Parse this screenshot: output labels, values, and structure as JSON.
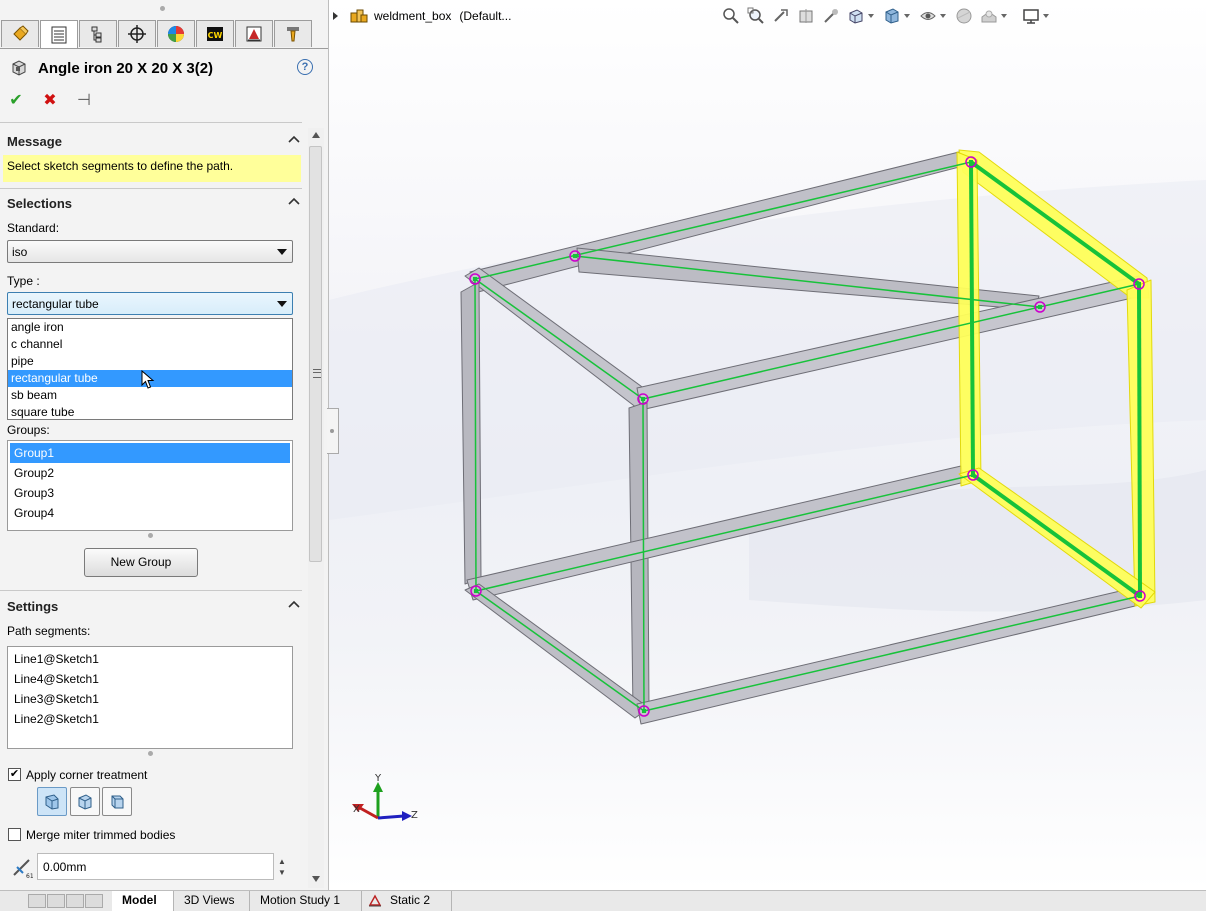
{
  "property_manager": {
    "title": "Angle iron 20 X 20 X 3(2)",
    "help": "?",
    "ok": "✔",
    "cancel": "✖",
    "pin": "⊣",
    "tabs": [
      "feature-manager",
      "property-manager",
      "configuration-manager",
      "dim-xpert-manager",
      "display-manager",
      "cam-manager",
      "simulation",
      "tool"
    ],
    "message": {
      "header": "Message",
      "text": "Select sketch segments to define the path."
    },
    "selections": {
      "header": "Selections",
      "standard_label": "Standard:",
      "standard_value": "iso",
      "type_label": "Type :",
      "type_value": "rectangular tube",
      "type_options": [
        "angle iron",
        "c channel",
        "pipe",
        "rectangular tube",
        "sb beam",
        "square tube"
      ],
      "type_selected_index": 3,
      "groups_label": "Groups:",
      "groups": [
        "Group1",
        "Group2",
        "Group3",
        "Group4"
      ],
      "groups_selected_index": 0,
      "new_group_label": "New Group"
    },
    "settings": {
      "header": "Settings",
      "path_label": "Path segments:",
      "path_segments": [
        "Line1@Sketch1",
        "Line4@Sketch1",
        "Line3@Sketch1",
        "Line2@Sketch1"
      ],
      "corner_label": "Apply corner treatment",
      "corner_checked": true,
      "merge_label": "Merge miter trimmed bodies",
      "merge_checked": false,
      "gap_value": "0.00mm"
    }
  },
  "graphics": {
    "part_name": "weldment_box",
    "configuration": "(Default...",
    "triad": {
      "x": "X",
      "y": "Y",
      "z": "Z"
    },
    "colors": {
      "path": "#17c23a",
      "highlight": "#f4f000",
      "member": "#b9b9c2",
      "vertex": "#cc00cc"
    }
  },
  "bottom_tabs": [
    "Model",
    "3D Views",
    "Motion Study 1",
    "Static 2"
  ],
  "active_bottom_tab": "Model"
}
